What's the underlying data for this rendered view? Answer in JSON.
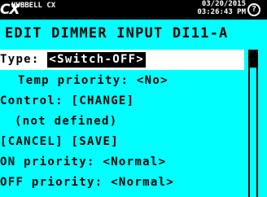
{
  "header": {
    "logo": "CX",
    "brand": "HUBBELL CX",
    "date": "03/20/2015",
    "time": "03:26:43 PM",
    "help_glyph": "?",
    "help_icon": "help-circle-icon"
  },
  "title": "EDIT DIMMER INPUT DI11-A",
  "menu": {
    "type_label": "Type:",
    "type_value": "<Switch-OFF>",
    "temp_priority": "Temp priority: <No>",
    "control": "Control: [CHANGE]",
    "not_defined": "(not defined)",
    "cancel_save": "[CANCEL]  [SAVE]",
    "on_priority": "ON priority:  <Normal>",
    "off_priority": "OFF priority:  <Normal>"
  },
  "colors": {
    "background": "#00ffff",
    "header_bg": "#000000",
    "header_text": "#ffffff",
    "selected_row_bg": "#ffffff",
    "selected_value_bg": "#000000"
  },
  "scrollbar": {
    "position_fraction": 0
  }
}
